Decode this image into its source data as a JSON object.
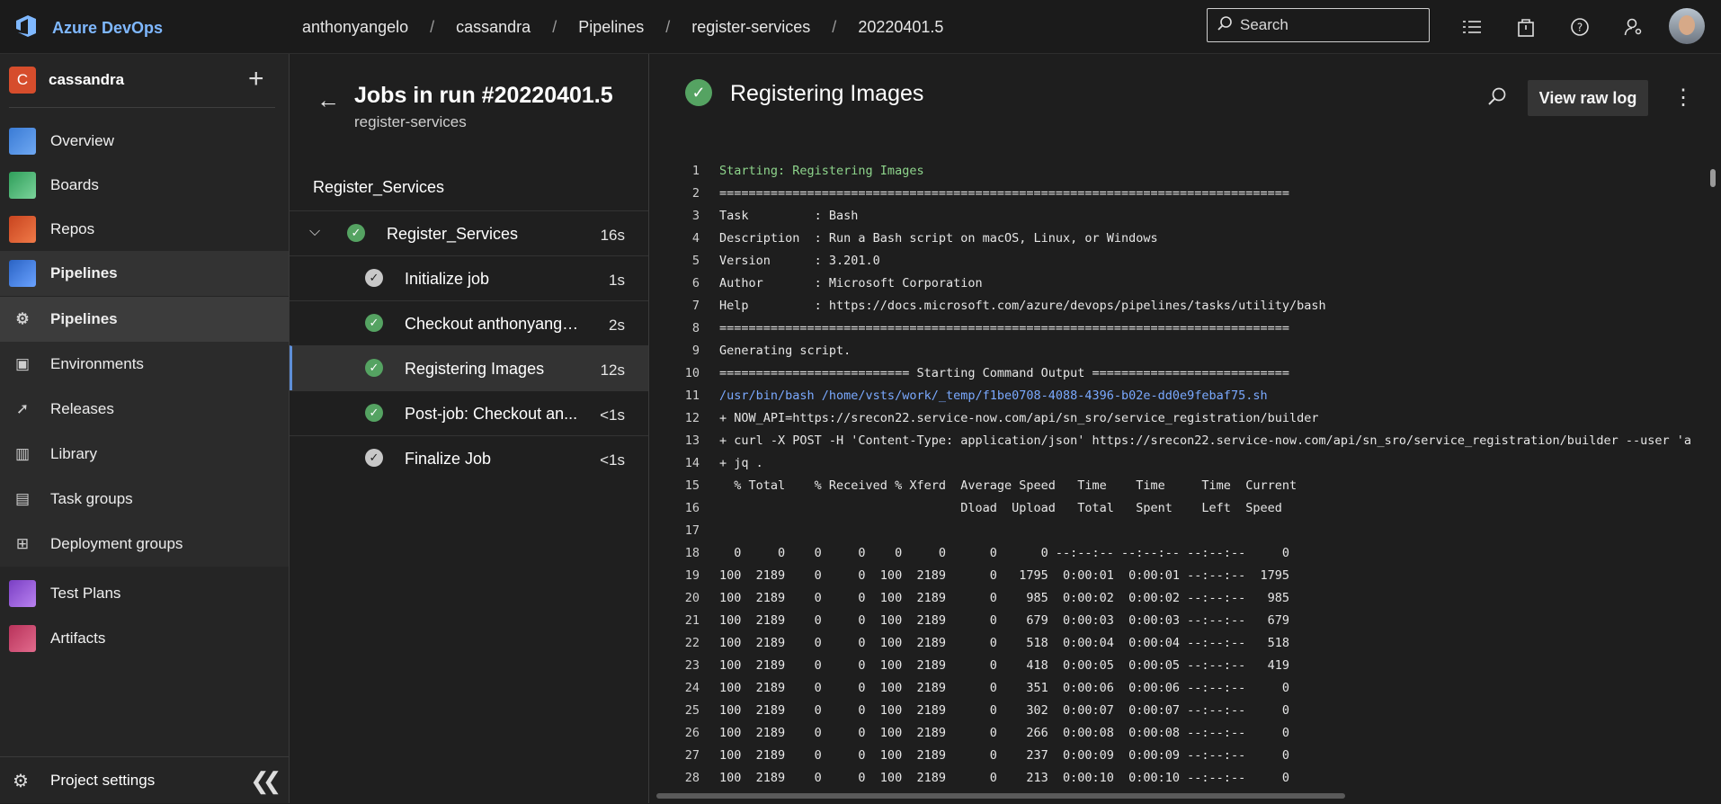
{
  "app": {
    "name": "Azure DevOps"
  },
  "breadcrumb": [
    "anthonyangelo",
    "cassandra",
    "Pipelines",
    "register-services",
    "20220401.5"
  ],
  "search": {
    "placeholder": "Search"
  },
  "project": {
    "name": "cassandra",
    "initial": "C"
  },
  "nav": {
    "overview": "Overview",
    "boards": "Boards",
    "repos": "Repos",
    "pipelines": "Pipelines",
    "sub": [
      "Pipelines",
      "Environments",
      "Releases",
      "Library",
      "Task groups",
      "Deployment groups"
    ],
    "test_plans": "Test Plans",
    "artifacts": "Artifacts",
    "project_settings": "Project settings"
  },
  "jobs": {
    "title": "Jobs in run #20220401.5",
    "subtitle": "register-services",
    "stage": "Register_Services",
    "job": {
      "name": "Register_Services",
      "duration": "16s"
    },
    "steps": [
      {
        "name": "Initialize job",
        "duration": "1s",
        "status": "done"
      },
      {
        "name": "Checkout anthonyangelo...",
        "duration": "2s",
        "status": "success"
      },
      {
        "name": "Registering Images",
        "duration": "12s",
        "status": "success"
      },
      {
        "name": "Post-job: Checkout an...",
        "duration": "<1s",
        "status": "success"
      },
      {
        "name": "Finalize Job",
        "duration": "<1s",
        "status": "done"
      }
    ]
  },
  "log": {
    "title": "Registering Images",
    "raw_button": "View raw log",
    "lines": [
      "Starting: Registering Images",
      "==============================================================================",
      "Task         : Bash",
      "Description  : Run a Bash script on macOS, Linux, or Windows",
      "Version      : 3.201.0",
      "Author       : Microsoft Corporation",
      "Help         : https://docs.microsoft.com/azure/devops/pipelines/tasks/utility/bash",
      "==============================================================================",
      "Generating script.",
      "========================== Starting Command Output ===========================",
      "/usr/bin/bash /home/vsts/work/_temp/f1be0708-4088-4396-b02e-dd0e9febaf75.sh",
      "+ NOW_API=https://srecon22.service-now.com/api/sn_sro/service_registration/builder",
      "+ curl -X POST -H 'Content-Type: application/json' https://srecon22.service-now.com/api/sn_sro/service_registration/builder --user 'a",
      "+ jq .",
      "  % Total    % Received % Xferd  Average Speed   Time    Time     Time  Current",
      "                                 Dload  Upload   Total   Spent    Left  Speed",
      "",
      "  0     0    0     0    0     0      0      0 --:--:-- --:--:-- --:--:--     0",
      "100  2189    0     0  100  2189      0   1795  0:00:01  0:00:01 --:--:--  1795",
      "100  2189    0     0  100  2189      0    985  0:00:02  0:00:02 --:--:--   985",
      "100  2189    0     0  100  2189      0    679  0:00:03  0:00:03 --:--:--   679",
      "100  2189    0     0  100  2189      0    518  0:00:04  0:00:04 --:--:--   518",
      "100  2189    0     0  100  2189      0    418  0:00:05  0:00:05 --:--:--   419",
      "100  2189    0     0  100  2189      0    351  0:00:06  0:00:06 --:--:--     0",
      "100  2189    0     0  100  2189      0    302  0:00:07  0:00:07 --:--:--     0",
      "100  2189    0     0  100  2189      0    266  0:00:08  0:00:08 --:--:--     0",
      "100  2189    0     0  100  2189      0    237  0:00:09  0:00:09 --:--:--     0",
      "100  2189    0     0  100  2189      0    213  0:00:10  0:00:10 --:--:--     0"
    ],
    "line_numbers": [
      "1",
      "2",
      "3",
      "4",
      "5",
      "6",
      "7",
      "8",
      "9",
      "10",
      "11",
      "12",
      "13",
      "14",
      "15",
      "16",
      "17",
      "18",
      "19",
      "20",
      "21",
      "22",
      "23",
      "24",
      "25",
      "26",
      "27",
      "28"
    ]
  },
  "colors": {
    "accent": "#5e8fd8",
    "success": "#55a362",
    "brand": "#7fb8ff"
  }
}
